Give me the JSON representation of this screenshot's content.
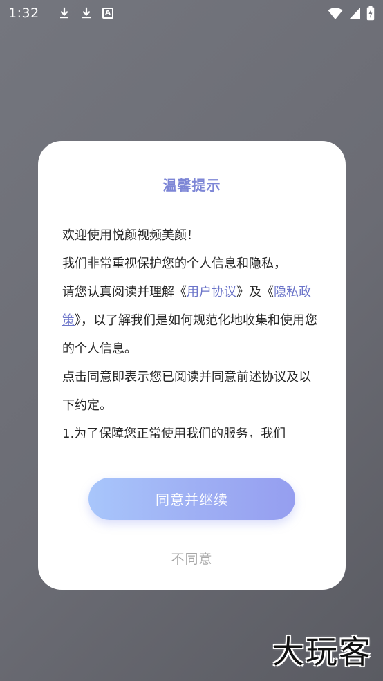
{
  "status_bar": {
    "time": "1:32",
    "left_icons": [
      "download-icon",
      "download-icon",
      "a-icon"
    ],
    "right_icons": [
      "wifi-icon",
      "signal-icon",
      "battery-icon"
    ],
    "a_icon_label": "A"
  },
  "dialog": {
    "title": "温馨提示",
    "paragraphs": {
      "line1": "欢迎使用悦颜视频美颜！",
      "line2": "我们非常重视保护您的个人信息和隐私，",
      "line3_pre": "请您认真阅读并理解《",
      "link_user_agreement": "用户协议",
      "line3_mid": "》及《",
      "link_privacy_policy": "隐私政策",
      "line3_post": "》，以了解我们是如何规范化地收集和使用您的个人信息。",
      "line4": "点击同意即表示您已阅读并同意前述协议及以下约定。",
      "line5": "1.为了保障您正常使用我们的服务，我们"
    },
    "primary_button": "同意并继续",
    "secondary_button": "不同意"
  },
  "watermark": "大玩客",
  "colors": {
    "title": "#7d86d6",
    "link": "#6b74c9",
    "button_gradient_start": "#a8c6fb",
    "button_gradient_end": "#959ef0",
    "secondary": "#a7a7a7"
  }
}
